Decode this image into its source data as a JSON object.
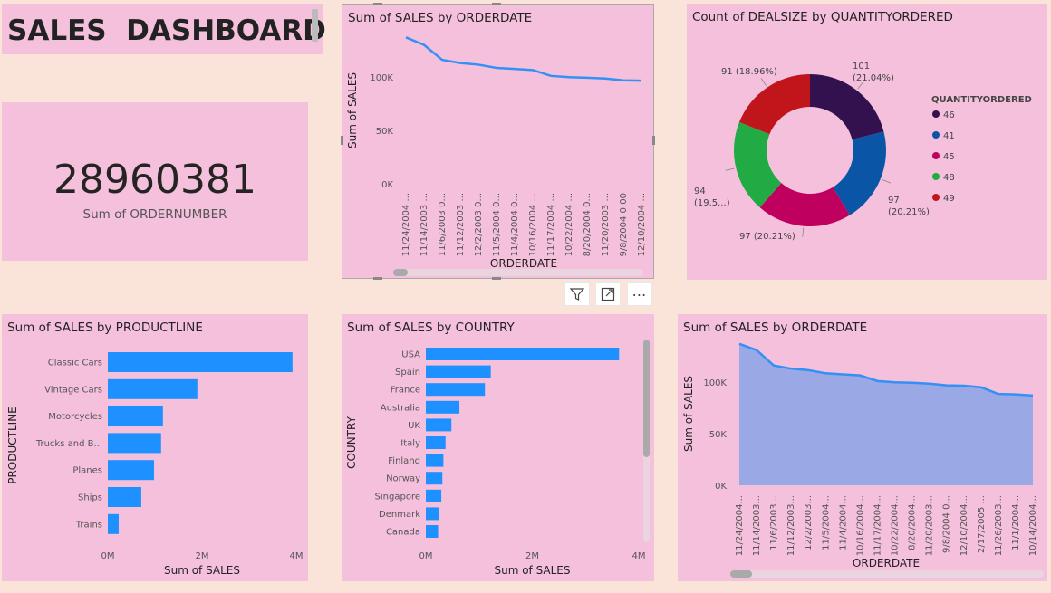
{
  "title": "SALES  DASHBOARD",
  "kpi": {
    "value": "28960381",
    "label": "Sum of ORDERNUMBER"
  },
  "icons": {
    "filter": "filter-icon",
    "focus": "focus-mode-icon",
    "more": "more-options-icon"
  },
  "colors": {
    "bar": "#1e90ff",
    "line": "#3390f5",
    "area_fill": "#9aa8e6",
    "panel": "#f4c0dc",
    "page": "#fae3d8"
  },
  "chart_data": [
    {
      "type": "line",
      "title": "Sum of SALES by ORDERDATE",
      "xlabel": "ORDERDATE",
      "ylabel": "Sum of SALES",
      "yticks": [
        "100K",
        "50K",
        "0K"
      ],
      "categories": [
        "11/24/2004 ...",
        "11/14/2003 ...",
        "11/6/2003 0...",
        "11/12/2003 ...",
        "12/2/2003 0...",
        "11/5/2004 0...",
        "11/4/2004 0...",
        "10/16/2004 ...",
        "11/17/2004 ...",
        "10/22/2004 ...",
        "8/20/2004 0...",
        "11/20/2003 ...",
        "9/8/2004 0:00",
        "12/10/2004 ..."
      ],
      "values": [
        137000,
        130000,
        116000,
        113000,
        111500,
        108500,
        107500,
        106500,
        101000,
        99800,
        99300,
        98500,
        96800,
        96500
      ],
      "ylim": [
        0,
        150000
      ]
    },
    {
      "type": "pie",
      "title": "Count of DEALSIZE by QUANTITYORDERED",
      "legend_title": "QUANTITYORDERED",
      "legend_position": "right",
      "slices": [
        {
          "name": "46",
          "value": 101,
          "label": "101",
          "pct": "(21.04%)",
          "color": "#33114f"
        },
        {
          "name": "41",
          "value": 97,
          "label": "97",
          "pct": "(20.21%)",
          "color": "#0a55a6"
        },
        {
          "name": "45",
          "value": 97,
          "label": "97 (20.21%)",
          "pct": "",
          "color": "#c0005e"
        },
        {
          "name": "48",
          "value": 94,
          "label": "94",
          "pct": "(19.5...)",
          "color": "#22aa44"
        },
        {
          "name": "49",
          "value": 91,
          "label": "91 (18.96%)",
          "pct": "",
          "color": "#c0151b"
        }
      ]
    },
    {
      "type": "bar",
      "title": "Sum of SALES by PRODUCTLINE",
      "xlabel": "Sum of SALES",
      "ylabel": "PRODUCTLINE",
      "xticks": [
        "0M",
        "2M",
        "4M"
      ],
      "xlim": [
        0,
        4000000
      ],
      "categories": [
        "Classic Cars",
        "Vintage Cars",
        "Motorcycles",
        "Trucks and B...",
        "Planes",
        "Ships",
        "Trains"
      ],
      "values": [
        3920000,
        1900000,
        1170000,
        1130000,
        980000,
        710000,
        230000
      ]
    },
    {
      "type": "bar",
      "title": "Sum of SALES by COUNTRY",
      "xlabel": "Sum of SALES",
      "ylabel": "COUNTRY",
      "xticks": [
        "0M",
        "2M",
        "4M"
      ],
      "xlim": [
        0,
        4000000
      ],
      "categories": [
        "USA",
        "Spain",
        "France",
        "Australia",
        "UK",
        "Italy",
        "Finland",
        "Norway",
        "Singapore",
        "Denmark",
        "Canada"
      ],
      "values": [
        3630000,
        1220000,
        1110000,
        630000,
        480000,
        370000,
        330000,
        310000,
        290000,
        250000,
        230000
      ]
    },
    {
      "type": "area",
      "title": "Sum of SALES by ORDERDATE",
      "xlabel": "ORDERDATE",
      "ylabel": "Sum of SALES",
      "yticks": [
        "100K",
        "50K",
        "0K"
      ],
      "categories": [
        "11/24/2004...",
        "11/14/2003...",
        "11/6/2003...",
        "11/12/2003...",
        "12/2/2003...",
        "11/5/2004...",
        "11/4/2004...",
        "10/16/2004...",
        "11/17/2004...",
        "10/22/2004...",
        "8/20/2004...",
        "11/20/2003...",
        "9/8/2004 0...",
        "12/10/2004...",
        "2/17/2005 ...",
        "11/26/2003...",
        "11/1/2004...",
        "10/14/2004..."
      ],
      "values": [
        137000,
        131000,
        116000,
        113000,
        111500,
        108500,
        107500,
        106500,
        101000,
        99800,
        99300,
        98500,
        96800,
        96500,
        95000,
        88500,
        88000,
        87000
      ],
      "ylim": [
        0,
        150000
      ]
    }
  ]
}
